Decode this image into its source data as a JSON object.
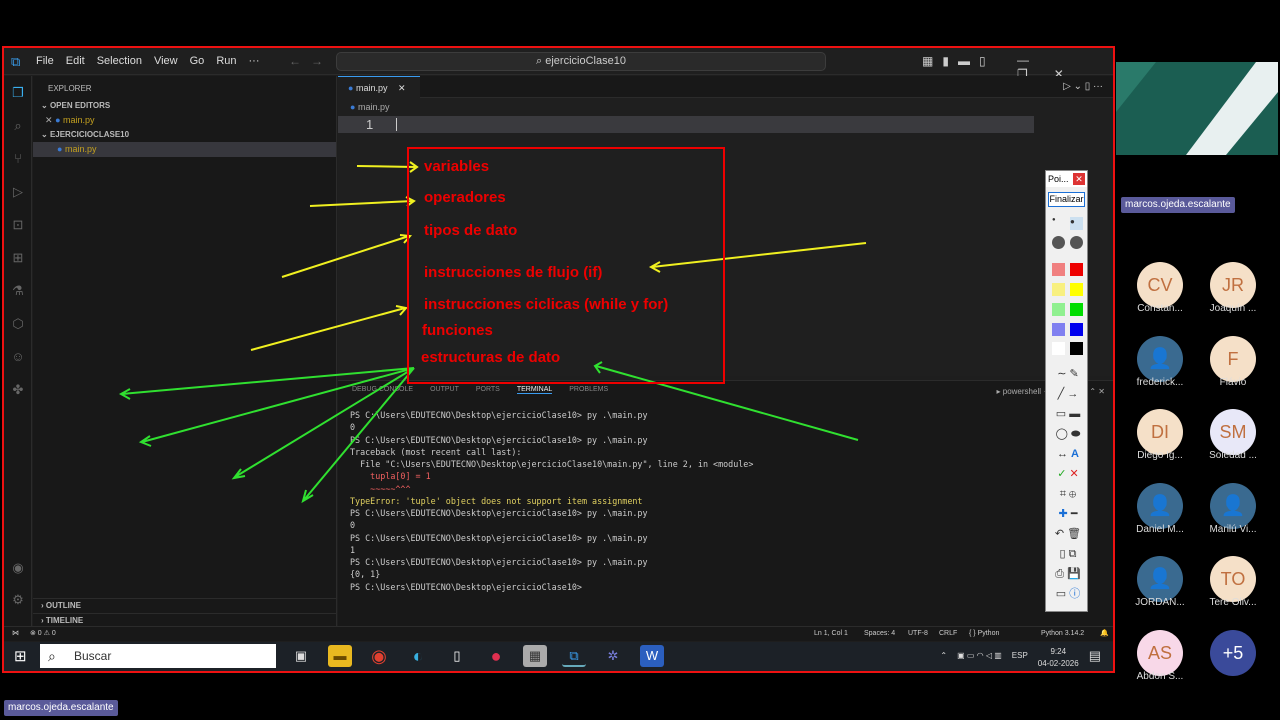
{
  "menu": [
    "File",
    "Edit",
    "Selection",
    "View",
    "Go",
    "Run",
    "···"
  ],
  "command_center": "ejercicioClase10",
  "sidebar": {
    "explorer_title": "EXPLORER",
    "open_editors": "OPEN EDITORS",
    "open_file": "main.py",
    "folder": "EJERCICIOCLASE10",
    "folder_file": "main.py",
    "outline": "OUTLINE",
    "timeline": "TIMELINE"
  },
  "editor": {
    "tab": "main.py",
    "breadcrumb": "main.py",
    "line_number": "1"
  },
  "panel": {
    "tabs": [
      "DEBUG CONSOLE",
      "OUTPUT",
      "PORTS",
      "TERMINAL",
      "PROBLEMS"
    ],
    "shell": "powershell"
  },
  "terminal": [
    {
      "t": "PS C:\\Users\\EDUTECNO\\Desktop\\ejercicioClase10> py .\\main.py",
      "c": "g"
    },
    {
      "t": "0",
      "c": "g"
    },
    {
      "t": "PS C:\\Users\\EDUTECNO\\Desktop\\ejercicioClase10> py .\\main.py",
      "c": "g"
    },
    {
      "t": "Traceback (most recent call last):",
      "c": "g"
    },
    {
      "t": "  File \"C:\\Users\\EDUTECNO\\Desktop\\ejercicioClase10\\main.py\", line 2, in <module>",
      "c": "g"
    },
    {
      "t": "    tupla[0] = 1",
      "c": "r"
    },
    {
      "t": "    ~~~~~^^^",
      "c": "r"
    },
    {
      "t": "TypeError: 'tuple' object does not support item assignment",
      "c": "y"
    },
    {
      "t": "PS C:\\Users\\EDUTECNO\\Desktop\\ejercicioClase10> py .\\main.py",
      "c": "g"
    },
    {
      "t": "0",
      "c": "g"
    },
    {
      "t": "PS C:\\Users\\EDUTECNO\\Desktop\\ejercicioClase10> py .\\main.py",
      "c": "g"
    },
    {
      "t": "1",
      "c": "g"
    },
    {
      "t": "PS C:\\Users\\EDUTECNO\\Desktop\\ejercicioClase10> py .\\main.py",
      "c": "g"
    },
    {
      "t": "{0, 1}",
      "c": "g"
    },
    {
      "t": "PS C:\\Users\\EDUTECNO\\Desktop\\ejercicioClase10> ",
      "c": "g"
    }
  ],
  "status": {
    "left": "⊗ 0 ⚠ 0",
    "ln": "Ln 1, Col 1",
    "spaces": "Spaces: 4",
    "enc": "UTF-8",
    "eol": "CRLF",
    "lang": "{ } Python",
    "ver": "Python 3.14.2"
  },
  "taskbar": {
    "search": "Buscar",
    "lang": "ESP",
    "time": "9:24",
    "date": "04-02-2026"
  },
  "annotations": [
    "variables",
    "operadores",
    "tipos de dato",
    "instrucciones de flujo (if)",
    "instrucciones ciclicas (while y for)",
    "funciones",
    "estructuras de dato"
  ],
  "palette": {
    "title": "Poi...",
    "finish": "Finalizar"
  },
  "participants": {
    "presenter": "marcos.ojeda.escalante",
    "list": [
      {
        "initials": "CV",
        "name": "Constan...",
        "color": "#f5e0c8"
      },
      {
        "initials": "JR",
        "name": "Joaquín ...",
        "color": "#f5e0c8"
      },
      {
        "initials": "",
        "name": "frederick...",
        "color": "#3a6a90"
      },
      {
        "initials": "F",
        "name": "Flávio",
        "color": "#f5e0c8"
      },
      {
        "initials": "DI",
        "name": "Diego Ig...",
        "color": "#f5e0c8"
      },
      {
        "initials": "SM",
        "name": "Soledad ...",
        "color": "#e8e8f8"
      },
      {
        "initials": "",
        "name": "Daniel M...",
        "color": "#3a6a90"
      },
      {
        "initials": "",
        "name": "Marilú Vi...",
        "color": "#3a6a90"
      },
      {
        "initials": "",
        "name": "JORDAN...",
        "color": "#3a6a90"
      },
      {
        "initials": "TO",
        "name": "Tere Oliv...",
        "color": "#f5e0c8"
      },
      {
        "initials": "AS",
        "name": "Abdon S...",
        "color": "#f8d8e8"
      },
      {
        "initials": "+5",
        "name": "",
        "color": "#3a4a9a"
      }
    ]
  },
  "bottom_chip": "marcos.ojeda.escalante"
}
